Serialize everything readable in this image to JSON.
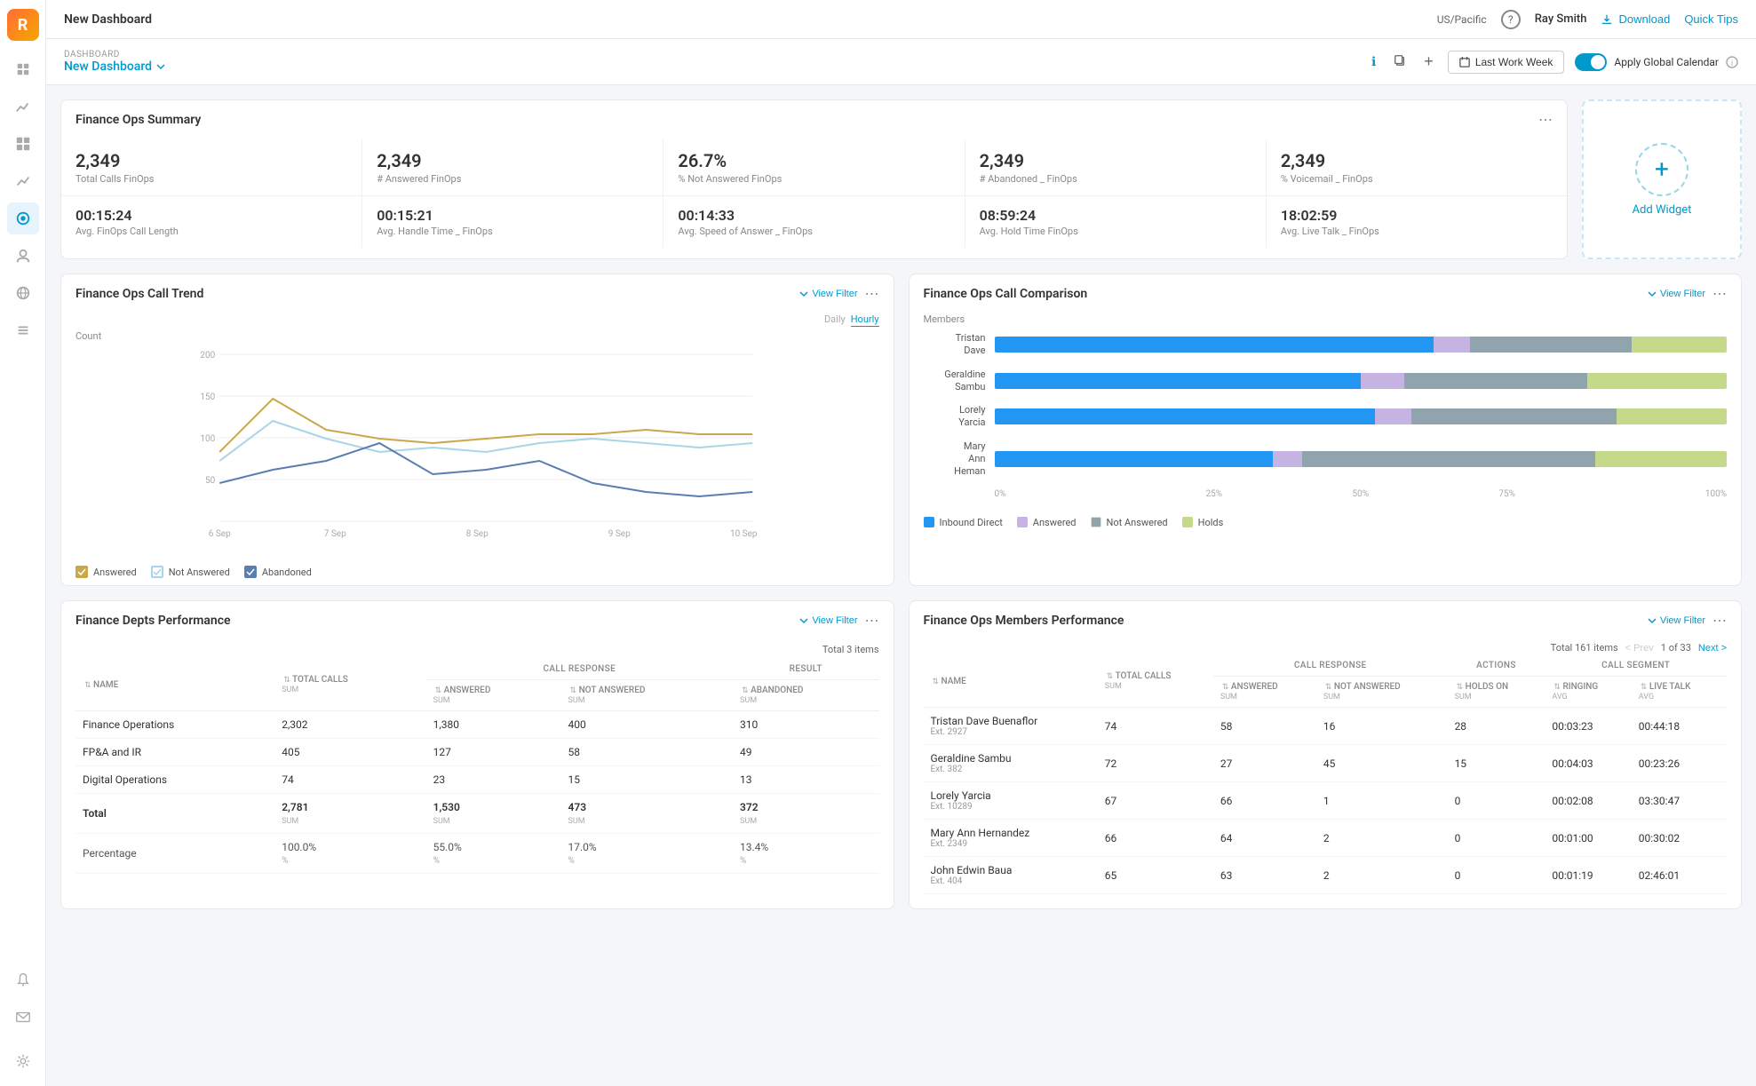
{
  "app": {
    "logo": "R",
    "timezone": "US/Pacific",
    "user": "Ray Smith"
  },
  "topbar": {
    "timezone": "US/Pacific",
    "user": "Ray Smith",
    "download_label": "Download",
    "quick_tips_label": "Quick Tips"
  },
  "subheader": {
    "dashboard_label": "DASHBOARD",
    "dashboard_name": "New Dashboard",
    "date_filter": "Last Work Week",
    "apply_calendar": "Apply Global Calendar"
  },
  "summary": {
    "title": "Finance Ops Summary",
    "metrics_row1": [
      {
        "value": "2,349",
        "label": "Total Calls FinOps"
      },
      {
        "value": "2,349",
        "label": "# Answered FinOps"
      },
      {
        "value": "26.7%",
        "label": "% Not Answered FinOps"
      },
      {
        "value": "2,349",
        "label": "# Abandoned _ FinOps"
      },
      {
        "value": "2,349",
        "label": "% Voicemail _ FinOps"
      }
    ],
    "metrics_row2": [
      {
        "value": "00:15:24",
        "label": "Avg. FinOps Call Length"
      },
      {
        "value": "00:15:21",
        "label": "Avg. Handle Time _ FinOps"
      },
      {
        "value": "00:14:33",
        "label": "Avg. Speed of Answer _ FinOps"
      },
      {
        "value": "08:59:24",
        "label": "Avg. Hold Time FinOps"
      },
      {
        "value": "18:02:59",
        "label": "Avg. Live Talk _ FinOps"
      }
    ]
  },
  "call_trend": {
    "title": "Finance Ops Call Trend",
    "y_label": "Count",
    "x_labels": [
      "6 Sep",
      "7 Sep",
      "8 Sep",
      "9 Sep",
      "10 Sep"
    ],
    "y_ticks": [
      "200",
      "150",
      "100",
      "50"
    ],
    "legend": [
      {
        "label": "Answered",
        "color": "#c9a84c"
      },
      {
        "label": "Not Answered",
        "color": "#a8d5e8"
      },
      {
        "label": "Abandoned",
        "color": "#5b7db1"
      }
    ],
    "tabs": [
      "Daily",
      "Hourly"
    ]
  },
  "call_comparison": {
    "title": "Finance Ops Call Comparison",
    "members_label": "Members",
    "members": [
      {
        "name": "Tristan\nDave",
        "inbound": 60,
        "answered": 5,
        "not_answered": 22,
        "holds": 13
      },
      {
        "name": "Geraldine\nSambu",
        "inbound": 50,
        "answered": 6,
        "not_answered": 25,
        "holds": 19
      },
      {
        "name": "Lorely\nYarcia",
        "inbound": 52,
        "answered": 5,
        "not_answered": 28,
        "holds": 15
      },
      {
        "name": "Mary\nAnn\nHeman",
        "inbound": 38,
        "answered": 4,
        "not_answered": 40,
        "holds": 18
      }
    ],
    "legend": [
      {
        "label": "Inbound Direct",
        "color": "#2196f3"
      },
      {
        "label": "Answered",
        "color": "#c5b4e3"
      },
      {
        "label": "Not Answered",
        "color": "#90a4ae"
      },
      {
        "label": "Holds",
        "color": "#c5d98a"
      }
    ],
    "x_axis": [
      "0%",
      "25%",
      "50%",
      "75%",
      "100%"
    ]
  },
  "dept_performance": {
    "title": "Finance Depts Performance",
    "total_items": "Total 3 items",
    "columns": {
      "name": "Name",
      "total_calls": "Total Calls",
      "call_response_group": "CALL RESPONSE",
      "answered": "Answered",
      "not_answered": "Not Answered",
      "result_group": "RESULT",
      "abandoned": "Abandoned"
    },
    "rows": [
      {
        "name": "Finance Operations",
        "total_calls": "2,302",
        "answered": "1,380",
        "not_answered": "400",
        "abandoned": "310"
      },
      {
        "name": "FP&A and IR",
        "total_calls": "405",
        "answered": "127",
        "not_answered": "58",
        "abandoned": "49"
      },
      {
        "name": "Digital Operations",
        "total_calls": "74",
        "answered": "23",
        "not_answered": "15",
        "abandoned": "13"
      }
    ],
    "total_row": {
      "name": "Total",
      "total_calls": "2,781",
      "answered": "1,530",
      "not_answered": "473",
      "abandoned": "372"
    },
    "pct_row": {
      "name": "Percentage",
      "total_calls": "100.0%",
      "answered": "55.0%",
      "not_answered": "17.0%",
      "abandoned": "13.4%"
    }
  },
  "members_performance": {
    "title": "Finance Ops Members Performance",
    "total_items": "Total 161 items",
    "pagination": {
      "prev": "< Prev",
      "current": "1 of 33",
      "next": "Next >"
    },
    "columns": {
      "name": "Name",
      "total_calls": "Total Calls",
      "call_response_group": "CALL RESPONSE",
      "answered": "Answered",
      "not_answered": "Not Answered",
      "actions_group": "ACTIONS",
      "holds_on": "Holds On",
      "call_segment_group": "CALL SEGMENT",
      "ringing": "Ringing",
      "live_talk": "Live Talk"
    },
    "rows": [
      {
        "name": "Tristan Dave Buenaflor",
        "ext": "Ext. 2927",
        "total_calls": "74",
        "answered": "58",
        "not_answered": "16",
        "holds_on": "28",
        "ringing": "00:03:23",
        "live_talk": "00:44:18"
      },
      {
        "name": "Geraldine Sambu",
        "ext": "Ext. 382",
        "total_calls": "72",
        "answered": "27",
        "not_answered": "45",
        "holds_on": "15",
        "ringing": "00:04:03",
        "live_talk": "00:23:26"
      },
      {
        "name": "Lorely Yarcia",
        "ext": "Ext. 10289",
        "total_calls": "67",
        "answered": "66",
        "not_answered": "1",
        "holds_on": "0",
        "ringing": "00:02:08",
        "live_talk": "03:30:47"
      },
      {
        "name": "Mary Ann Hernandez",
        "ext": "Ext. 2349",
        "total_calls": "66",
        "answered": "64",
        "not_answered": "2",
        "holds_on": "0",
        "ringing": "00:01:00",
        "live_talk": "00:30:02"
      },
      {
        "name": "John Edwin Baua",
        "ext": "Ext. 404",
        "total_calls": "65",
        "answered": "63",
        "not_answered": "2",
        "holds_on": "0",
        "ringing": "00:01:19",
        "live_talk": "02:46:01"
      }
    ]
  },
  "sidebar_icons": [
    {
      "name": "home-icon",
      "glyph": "⊞"
    },
    {
      "name": "chart-icon",
      "glyph": "📊"
    },
    {
      "name": "dashboard-icon",
      "glyph": "▦"
    },
    {
      "name": "analytics-icon",
      "glyph": "📈"
    },
    {
      "name": "active-icon",
      "glyph": "◫"
    },
    {
      "name": "user-icon",
      "glyph": "👤"
    },
    {
      "name": "globe-icon",
      "glyph": "🌐"
    },
    {
      "name": "list-icon",
      "glyph": "☰"
    },
    {
      "name": "bell-icon",
      "glyph": "🔔"
    },
    {
      "name": "mail-icon",
      "glyph": "✉"
    },
    {
      "name": "settings-icon",
      "glyph": "⚙"
    }
  ],
  "colors": {
    "blue": "#2196f3",
    "light_blue": "#a8d5e8",
    "dark_blue": "#5b7db1",
    "gold": "#c9a84c",
    "purple": "#c5b4e3",
    "gray": "#90a4ae",
    "green": "#c5d98a",
    "accent": "#0099cc"
  }
}
